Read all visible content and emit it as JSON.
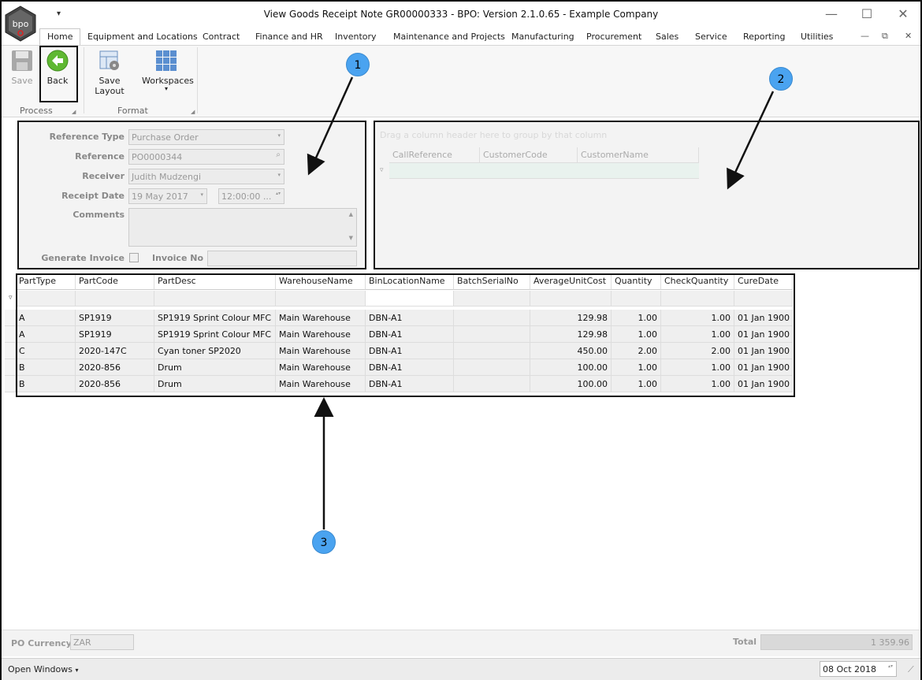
{
  "window": {
    "title": "View Goods Receipt Note GR00000333 - BPO: Version 2.1.0.65 - Example Company",
    "logo_text": "bpo",
    "qat_glyph": "▾",
    "minimize_glyph": "—",
    "maximize_glyph": "☐",
    "close_glyph": "✕"
  },
  "ribbon": {
    "tabs": [
      "Home",
      "Equipment and Locations",
      "Contract",
      "Finance and HR",
      "Inventory",
      "Maintenance and Projects",
      "Manufacturing",
      "Procurement",
      "Sales",
      "Service",
      "Reporting",
      "Utilities"
    ],
    "mdi_controls": [
      "—",
      "⧉",
      "✕"
    ],
    "buttons": {
      "save": "Save",
      "back": "Back",
      "save_layout": "Save Layout",
      "workspaces": "Workspaces",
      "workspaces_arrow": "▾"
    },
    "groups": {
      "process": "Process",
      "format": "Format"
    },
    "launcher_glyph": "◢"
  },
  "form": {
    "reference_type_label": "Reference Type",
    "reference_type_value": "Purchase Order",
    "reference_label": "Reference",
    "reference_value": "PO0000344",
    "receiver_label": "Receiver",
    "receiver_value": "Judith Mudzengi",
    "receipt_date_label": "Receipt Date",
    "receipt_date_value": "19 May 2017",
    "receipt_time_value": "12:00:00 ...",
    "comments_label": "Comments",
    "comments_value": "",
    "generate_invoice_label": "Generate Invoice",
    "invoice_no_label": "Invoice No",
    "invoice_no_value": "",
    "dropdown_glyph": "▾",
    "search_glyph": "⌕",
    "spin_glyph": "▴▾"
  },
  "call_grid": {
    "group_hint": "Drag a column header here to group by that column",
    "columns": [
      "CallReference",
      "CustomerCode",
      "CustomerName"
    ],
    "filter_glyph": "▿"
  },
  "parts_grid": {
    "filter_glyph": "▿",
    "columns": [
      "PartType",
      "PartCode",
      "PartDesc",
      "WarehouseName",
      "BinLocationName",
      "BatchSerialNo",
      "AverageUnitCost",
      "Quantity",
      "CheckQuantity",
      "CureDate"
    ],
    "rows": [
      [
        "A",
        "SP1919",
        "SP1919 Sprint Colour MFC",
        "Main Warehouse",
        "DBN-A1",
        "",
        "129.98",
        "1.00",
        "1.00",
        "01 Jan 1900"
      ],
      [
        "A",
        "SP1919",
        "SP1919 Sprint Colour MFC",
        "Main Warehouse",
        "DBN-A1",
        "",
        "129.98",
        "1.00",
        "1.00",
        "01 Jan 1900"
      ],
      [
        "C",
        "2020-147C",
        "Cyan toner SP2020",
        "Main Warehouse",
        "DBN-A1",
        "",
        "450.00",
        "2.00",
        "2.00",
        "01 Jan 1900"
      ],
      [
        "B",
        "2020-856",
        "Drum",
        "Main Warehouse",
        "DBN-A1",
        "",
        "100.00",
        "1.00",
        "1.00",
        "01 Jan 1900"
      ],
      [
        "B",
        "2020-856",
        "Drum",
        "Main Warehouse",
        "DBN-A1",
        "",
        "100.00",
        "1.00",
        "1.00",
        "01 Jan 1900"
      ]
    ]
  },
  "annotations": [
    "1",
    "2",
    "3"
  ],
  "footer": {
    "po_currency_label": "PO Currency",
    "po_currency_value": "ZAR",
    "total_label": "Total",
    "total_value": "1 359.96"
  },
  "statusbar": {
    "open_windows": "Open Windows",
    "open_windows_arrow": "▾",
    "date": "08 Oct 2018",
    "spin_glyph": "▴▾",
    "grip_glyph": "⟋"
  },
  "colors": {
    "accent_blue": "#4aa3f0",
    "back_green": "#5fb832",
    "highlight_border": "#111111"
  }
}
